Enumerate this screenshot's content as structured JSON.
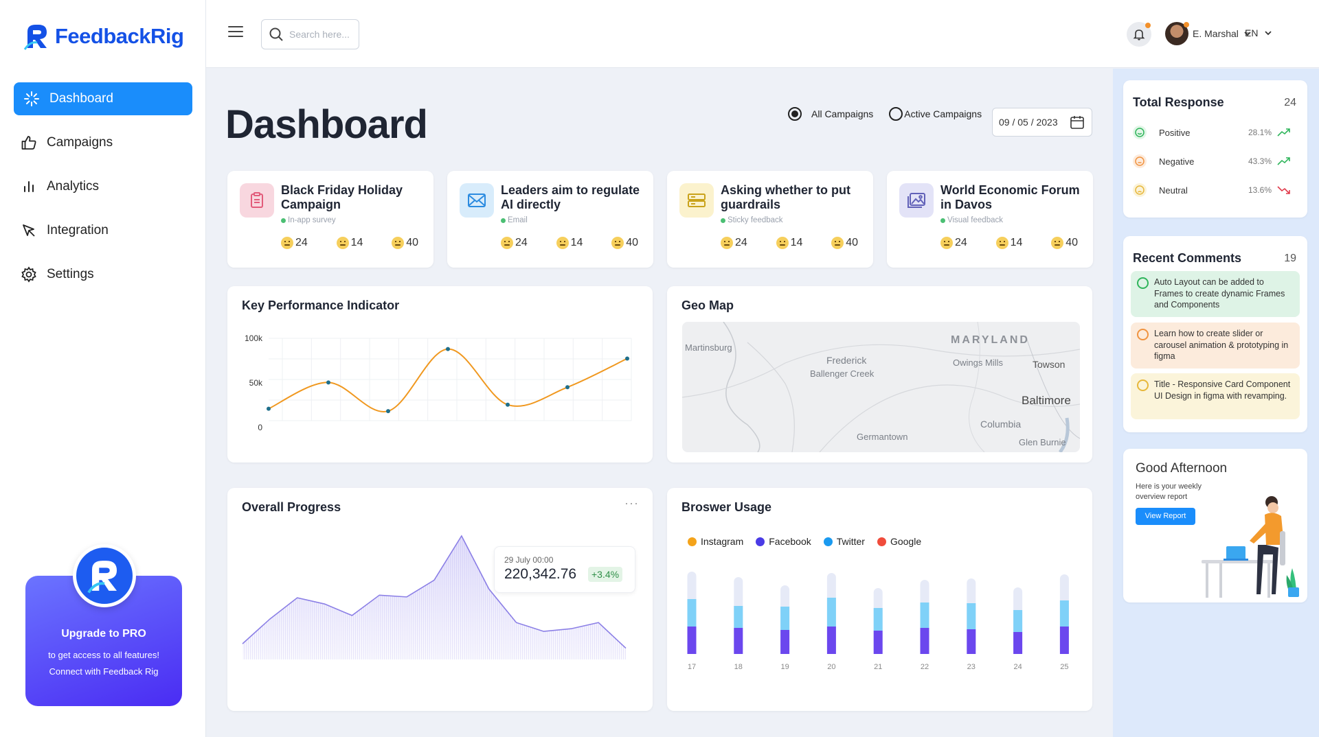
{
  "app": {
    "name": "FeedbackRig"
  },
  "sidebar": {
    "items": [
      {
        "label": "Dashboard",
        "icon": "dashboard-icon",
        "active": true
      },
      {
        "label": "Campaigns",
        "icon": "thumbs-up-icon"
      },
      {
        "label": "Analytics",
        "icon": "bar-chart-icon"
      },
      {
        "label": "Integration",
        "icon": "cursor-icon"
      },
      {
        "label": "Settings",
        "icon": "gear-icon"
      }
    ],
    "promo": {
      "title": "Upgrade to PRO",
      "line1": "to get access to all features!",
      "line2": "Connect with Feedback Rig"
    }
  },
  "topbar": {
    "search_placeholder": "Search here...",
    "user_name": "E. Marshal",
    "language": "EN"
  },
  "page": {
    "title": "Dashboard",
    "filter_all": "All Campaigns",
    "filter_active": "Active Campaigns",
    "selected_filter": "All Campaigns",
    "date": "09 / 05 / 2023"
  },
  "campaigns": [
    {
      "title": "Black Friday Holiday Campaign",
      "type": "In-app survey",
      "icon": "clipboard-icon",
      "color": "#f8d7df",
      "icon_color": "#e25b7a",
      "stats": [
        "24",
        "14",
        "40"
      ]
    },
    {
      "title": "Leaders aim to regulate AI directly",
      "type": "Email",
      "icon": "mail-icon",
      "color": "#d8ecfb",
      "icon_color": "#2b8be0",
      "stats": [
        "24",
        "14",
        "40"
      ]
    },
    {
      "title": "Asking whether to put guardrails",
      "type": "Sticky feedback",
      "icon": "sticky-note-icon",
      "color": "#fbf2cd",
      "icon_color": "#c9a21a",
      "stats": [
        "24",
        "14",
        "40"
      ]
    },
    {
      "title": "World Economic Forum in Davos",
      "type": "Visual feedback",
      "icon": "image-icon",
      "color": "#e3e3f7",
      "icon_color": "#6161b8",
      "stats": [
        "24",
        "14",
        "40"
      ]
    }
  ],
  "kpi": {
    "title": "Key Performance Indicator",
    "y_ticks": [
      "100k",
      "50k",
      "0"
    ]
  },
  "geo": {
    "title": "Geo Map",
    "labels": [
      "MARYLAND",
      "Martinsburg",
      "Frederick",
      "Ballenger Creek",
      "Owings Mills",
      "Towson",
      "Baltimore",
      "Columbia",
      "Germantown",
      "Glen Burnie"
    ]
  },
  "progress": {
    "title": "Overall Progress",
    "menu": "···",
    "tooltip_date": "29 July 00:00",
    "tooltip_value": "220,342.76",
    "tooltip_delta": "+3.4%"
  },
  "browser": {
    "title": "Broswer Usage"
  },
  "total_response": {
    "title": "Total Response",
    "count": "24",
    "rows": [
      {
        "label": "Positive",
        "pct": "28.1%",
        "color": "#2fb55b",
        "bg": "#e2f6e7",
        "trend": "up"
      },
      {
        "label": "Negative",
        "pct": "43.3%",
        "color": "#f09340",
        "bg": "#fdebdc",
        "trend": "up"
      },
      {
        "label": "Neutral",
        "pct": "13.6%",
        "color": "#e7b73a",
        "bg": "#fbf3d9",
        "trend": "down"
      }
    ]
  },
  "recent_comments": {
    "title": "Recent Comments",
    "count": "19",
    "items": [
      {
        "text": "Auto Layout can be added to Frames to create dynamic Frames and Components",
        "bg": "#def3e6",
        "color": "#2fb55b"
      },
      {
        "text": "Learn how to create slider or carousel animation & prototyping in figma",
        "bg": "#fcebdc",
        "color": "#f09340"
      },
      {
        "text": "Title - Responsive Card Component UI Design in figma with revamping.",
        "bg": "#fbf4da",
        "color": "#e7b73a"
      }
    ]
  },
  "greeting": {
    "title": "Good Afternoon",
    "subtitle": "Here is your weekly overview report",
    "button": "View Report"
  },
  "chart_data": [
    {
      "type": "line",
      "title": "Key Performance Indicator",
      "x": [
        1,
        2,
        3,
        4,
        5,
        6,
        7
      ],
      "values": [
        15000,
        48000,
        12000,
        90000,
        20000,
        42000,
        78000
      ],
      "ylim": [
        0,
        100000
      ],
      "y_tick_labels": [
        "0",
        "50k",
        "100k"
      ],
      "grid": true,
      "color": "#f0981f"
    },
    {
      "type": "area",
      "title": "Overall Progress",
      "values": [
        10,
        38,
        62,
        55,
        42,
        65,
        63,
        82,
        132,
        72,
        34,
        24,
        27,
        34,
        5
      ],
      "highlight_index": 8,
      "color": "#8b7fe6"
    },
    {
      "type": "bar",
      "title": "Broswer Usage",
      "categories": [
        "17",
        "18",
        "19",
        "20",
        "21",
        "22",
        "23",
        "24",
        "25"
      ],
      "series": [
        {
          "name": "Instagram",
          "color": "#f4a31a",
          "values": [
            0,
            0,
            0,
            0,
            0,
            0,
            0,
            0,
            0
          ]
        },
        {
          "name": "Facebook",
          "color": "#6b47ee",
          "values": [
            40,
            38,
            35,
            40,
            34,
            38,
            36,
            32,
            40
          ]
        },
        {
          "name": "Twitter",
          "color": "#7fd1f8",
          "values": [
            40,
            32,
            34,
            42,
            33,
            37,
            38,
            32,
            38
          ]
        },
        {
          "name": "Google",
          "color": "#f04c3b",
          "values": [
            0,
            0,
            0,
            0,
            0,
            0,
            0,
            0,
            0
          ]
        }
      ],
      "track_totals": [
        120,
        112,
        100,
        118,
        96,
        108,
        110,
        97,
        116
      ]
    }
  ]
}
